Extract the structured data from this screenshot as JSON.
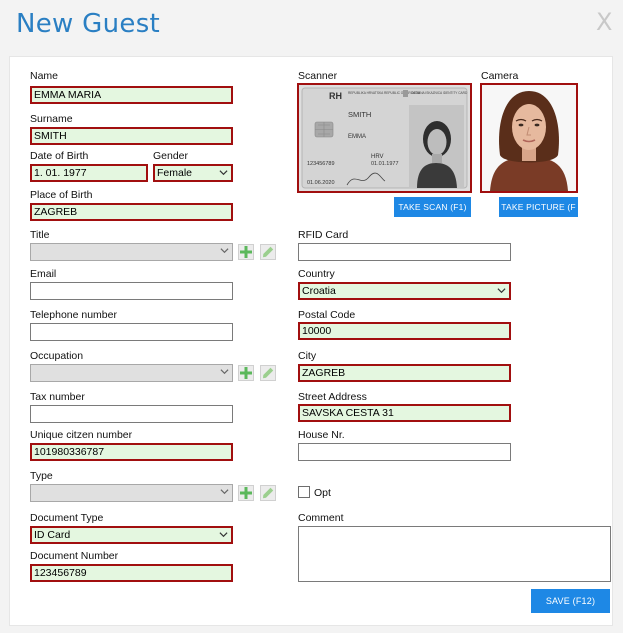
{
  "window": {
    "title": "New Guest",
    "close_glyph": "X"
  },
  "labels": {
    "name": "Name",
    "surname": "Surname",
    "dob": "Date of Birth",
    "gender": "Gender",
    "place_of_birth": "Place of Birth",
    "title": "Title",
    "email": "Email",
    "telephone": "Telephone number",
    "occupation": "Occupation",
    "tax_number": "Tax number",
    "unique_citizen_number": "Unique citzen number",
    "type": "Type",
    "document_type": "Document Type",
    "document_number": "Document Number",
    "scanner": "Scanner",
    "camera": "Camera",
    "rfid_card": "RFID Card",
    "country": "Country",
    "postal_code": "Postal Code",
    "city": "City",
    "street_address": "Street Address",
    "house_nr": "House Nr.",
    "opt": "Opt",
    "comment": "Comment"
  },
  "values": {
    "name": "EMMA MARIA",
    "surname": "SMITH",
    "dob": "1. 01. 1977",
    "gender": "Female",
    "place_of_birth": "ZAGREB",
    "title": "",
    "email": "",
    "telephone": "",
    "occupation": "",
    "tax_number": "",
    "unique_citizen_number": "101980336787",
    "type": "",
    "document_type": "ID Card",
    "document_number": "123456789",
    "rfid_card": "",
    "country": "Croatia",
    "postal_code": "10000",
    "city": "ZAGREB",
    "street_address": "SAVSKA CESTA 31",
    "house_nr": "",
    "opt_checked": false,
    "comment": ""
  },
  "id_card": {
    "country_code": "RH",
    "header_left": "REPUBLIKA HRVATSKA REPUBLIC OF CROATIA",
    "header_right": "OSOBNA ISKAZNICA IDENTITY CARD",
    "surname": "SMITH",
    "given_name": "EMMA",
    "nationality": "HRV",
    "birth_date": "01.01.1977",
    "doc_number": "123456789",
    "expiry": "01.06.2020"
  },
  "buttons": {
    "take_scan": "TAKE SCAN (F1)",
    "take_picture": "TAKE  PICTURE  (F",
    "save": "SAVE (F12)"
  },
  "icons": {
    "add": "plus-icon",
    "edit": "pencil-icon",
    "dropdown": "chevron-down-icon"
  },
  "colors": {
    "title": "#2a7fc3",
    "required_border": "#a10f0f",
    "required_fill": "#e4f7e0",
    "button": "#1e88e5",
    "add_icon": "#5cb85c"
  }
}
